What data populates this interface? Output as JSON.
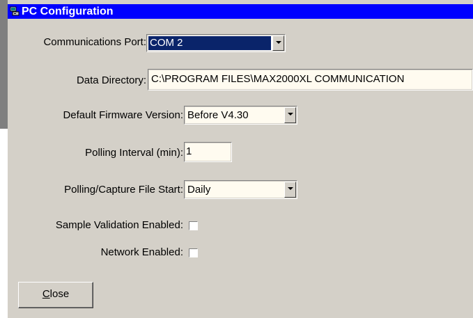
{
  "window": {
    "title": "PC Configuration",
    "icon": "pc-config-icon"
  },
  "form": {
    "comm_port": {
      "label": "Communications Port:",
      "value": "COM 2"
    },
    "data_directory": {
      "label": "Data Directory:",
      "value": "C:\\PROGRAM FILES\\MAX2000XL COMMUNICATION"
    },
    "firmware_version": {
      "label": "Default Firmware Version:",
      "value": "Before V4.30"
    },
    "polling_interval": {
      "label": "Polling Interval (min):",
      "value": "1"
    },
    "capture_file_start": {
      "label": "Polling/Capture File Start:",
      "value": "Daily"
    },
    "sample_validation": {
      "label": "Sample Validation Enabled:",
      "checked": false
    },
    "network_enabled": {
      "label": "Network Enabled:",
      "checked": false
    }
  },
  "buttons": {
    "close_label_mnemonic": "C",
    "close_label_rest": "lose"
  },
  "colors": {
    "titlebar": "#0000ff",
    "dialog_bg": "#d4d0c8",
    "field_bg": "#fffbf0",
    "selection": "#0a246a"
  }
}
